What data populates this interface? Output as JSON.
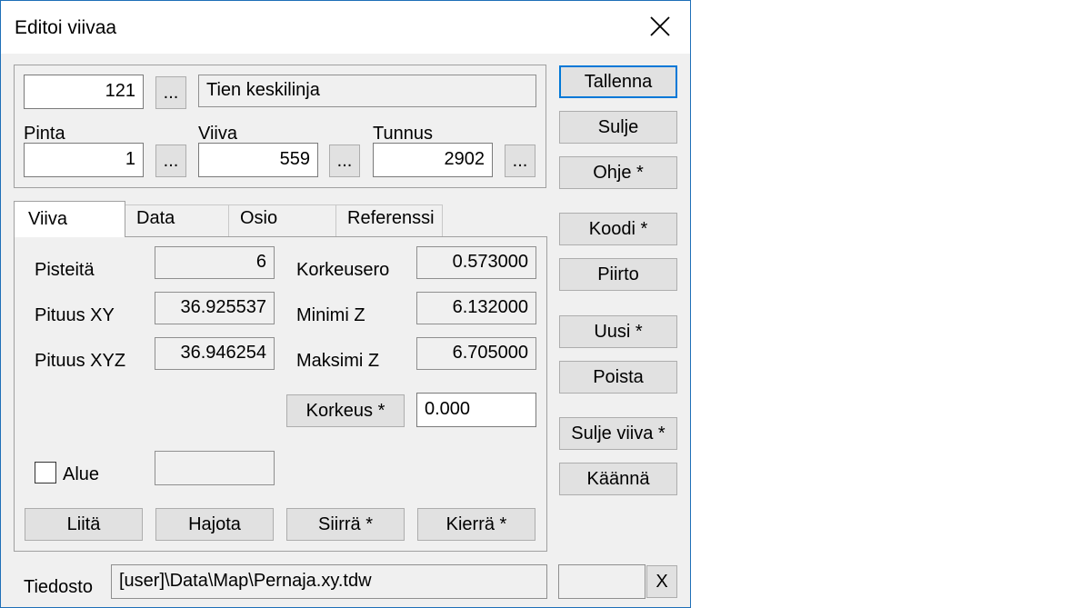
{
  "window": {
    "title": "Editoi viivaa"
  },
  "top": {
    "code_value": "121",
    "browse_label": "...",
    "code_name": "Tien keskilinja",
    "pinta_label": "Pinta",
    "pinta_value": "1",
    "viiva_label": "Viiva",
    "viiva_value": "559",
    "tunnus_label": "Tunnus",
    "tunnus_value": "2902"
  },
  "tabs": [
    "Viiva",
    "Data",
    "Osio",
    "Referenssi"
  ],
  "panel": {
    "pisteita_label": "Pisteitä",
    "pisteita_value": "6",
    "pituus_xy_label": "Pituus XY",
    "pituus_xy_value": "36.925537",
    "pituus_xyz_label": "Pituus XYZ",
    "pituus_xyz_value": "36.946254",
    "korkeusero_label": "Korkeusero",
    "korkeusero_value": "0.573000",
    "minimi_z_label": "Minimi Z",
    "minimi_z_value": "6.132000",
    "maksimi_z_label": "Maksimi Z",
    "maksimi_z_value": "6.705000",
    "korkeus_button": "Korkeus *",
    "korkeus_value": "0.000",
    "alue_label": "Alue",
    "alue_value": "",
    "liita": "Liitä",
    "hajota": "Hajota",
    "siirra": "Siirrä *",
    "kierra": "Kierrä *"
  },
  "side_buttons": {
    "tallenna": "Tallenna",
    "sulje": "Sulje",
    "ohje": "Ohje *",
    "koodi": "Koodi *",
    "piirto": "Piirto",
    "uusi": "Uusi *",
    "poista": "Poista",
    "sulje_viiva": "Sulje viiva *",
    "kaanna": "Käännä"
  },
  "footer": {
    "tiedosto_label": "Tiedosto",
    "tiedosto_value": "[user]\\Data\\Map\\Pernaja.xy.tdw",
    "extra_value": "",
    "clear_label": "X"
  },
  "icons": {
    "close": "close-icon"
  }
}
